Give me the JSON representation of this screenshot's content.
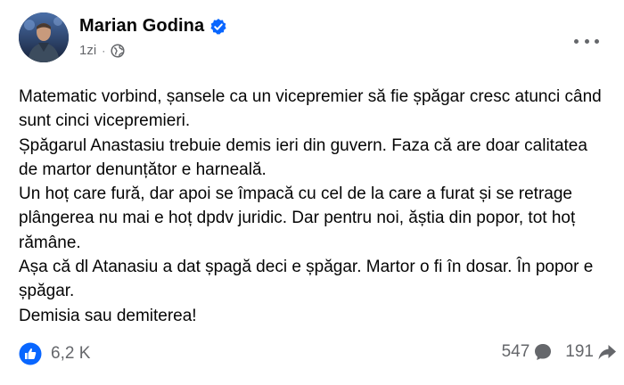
{
  "post": {
    "author": {
      "name": "Marian Godina",
      "verified": true,
      "avatar_icon": "profile-photo"
    },
    "meta": {
      "time": "1zi",
      "separator": "·",
      "audience_icon": "globe-icon"
    },
    "more_icon": "more-options-icon",
    "paragraphs": [
      "Matematic vorbind, șansele ca un vicepremier să fie șpăgar cresc atunci când sunt cinci vicepremieri.",
      "Șpăgarul Anastasiu trebuie demis ieri din guvern. Faza că are doar calitatea de martor denunțător e harneală.",
      "Un hoț care fură, dar apoi se împacă cu cel de la care a furat și se retrage plângerea nu mai e hoț dpdv juridic. Dar pentru noi, ăștia din popor, tot hoț rămâne.",
      "Așa că dl Atanasiu a dat șpagă deci e șpăgar. Martor o fi în dosar. În popor e șpăgar.",
      "Demisia sau demiterea!"
    ],
    "footer": {
      "reaction_icon": "like-icon",
      "reaction_count": "6,2 K",
      "comments_count": "547",
      "comments_icon": "comment-icon",
      "shares_count": "191",
      "shares_icon": "share-icon"
    }
  },
  "colors": {
    "text": "#050505",
    "muted": "#65676b",
    "brand_blue": "#0866ff"
  }
}
